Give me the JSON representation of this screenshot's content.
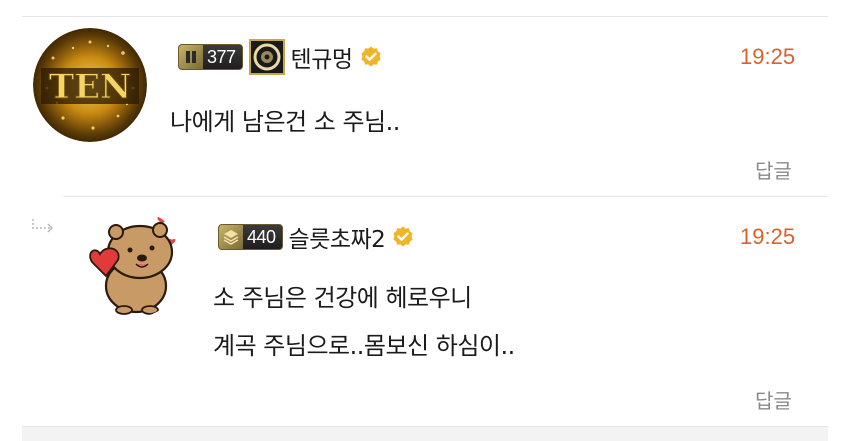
{
  "comments": [
    {
      "level": "377",
      "nickname": "텐규멍",
      "time": "19:25",
      "text": "나에게 남은건 소 주님..",
      "reply_label": "답글",
      "avatar_text": "TEN",
      "verified": true
    },
    {
      "level": "440",
      "nickname": "슬릇초짜2",
      "time": "19:25",
      "text_lines": [
        "소 주님은 건강에 헤로우니",
        "계곡 주님으로..몸보신 하심이.."
      ],
      "reply_label": "답글",
      "verified": true
    }
  ],
  "colors": {
    "time": "#d9622b",
    "verified": "#f0b429",
    "reply_label": "#8a8a8a",
    "divider": "#e6e6e6"
  },
  "icons": [
    "level-badge-icon",
    "emblem-icon",
    "verified-icon",
    "reply-arrow-icon",
    "avatar-gold-ten",
    "avatar-bear-heart"
  ]
}
